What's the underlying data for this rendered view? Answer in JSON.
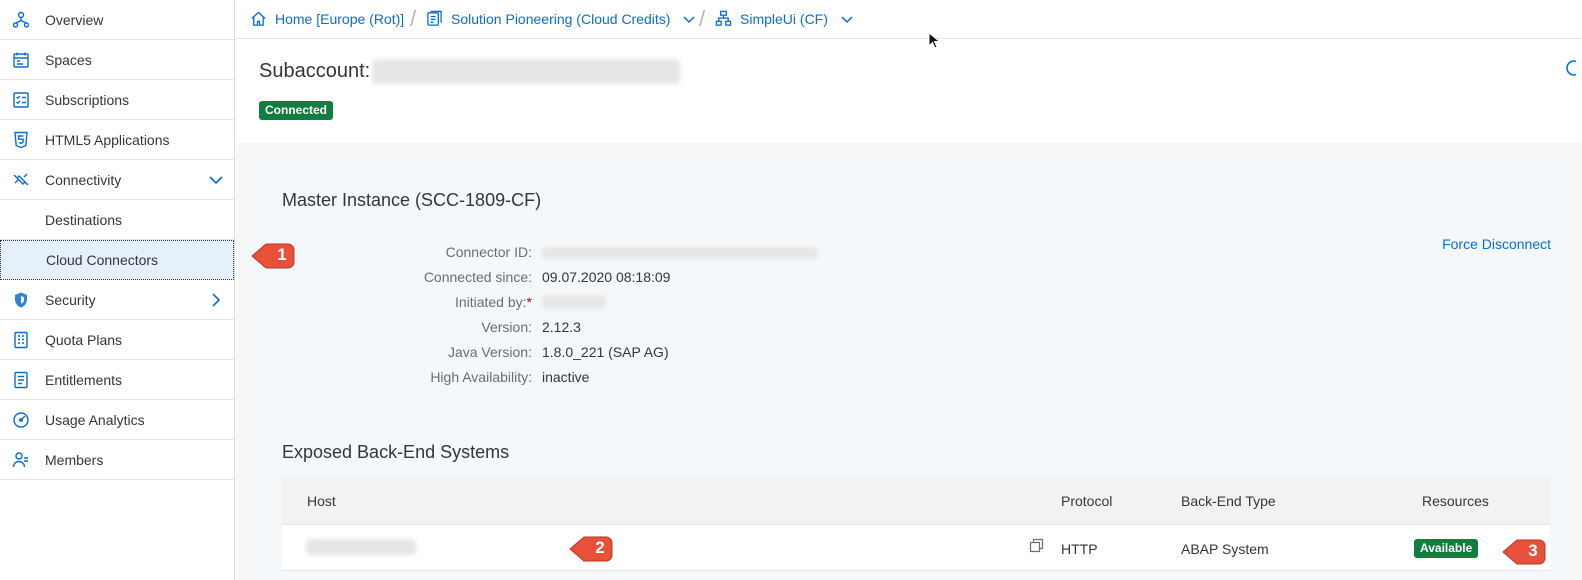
{
  "sidebar": {
    "items": [
      {
        "label": "Overview",
        "icon": "overview-icon"
      },
      {
        "label": "Spaces",
        "icon": "spaces-icon"
      },
      {
        "label": "Subscriptions",
        "icon": "subscriptions-icon"
      },
      {
        "label": "HTML5 Applications",
        "icon": "html5-icon"
      },
      {
        "label": "Connectivity",
        "icon": "connectivity-icon",
        "expanded": true
      },
      {
        "label": "Destinations"
      },
      {
        "label": "Cloud Connectors",
        "selected": true
      },
      {
        "label": "Security",
        "icon": "shield-icon"
      },
      {
        "label": "Quota Plans",
        "icon": "quota-icon"
      },
      {
        "label": "Entitlements",
        "icon": "entitlements-icon"
      },
      {
        "label": "Usage Analytics",
        "icon": "gauge-icon"
      },
      {
        "label": "Members",
        "icon": "members-icon"
      }
    ]
  },
  "breadcrumb": {
    "home": "Home [Europe (Rot)]",
    "globalaccount": "Solution Pioneering (Cloud Credits)",
    "subaccount": "SimpleUi (CF)"
  },
  "header": {
    "title": "Subaccount:",
    "status": "Connected"
  },
  "master": {
    "title": "Master Instance (SCC-1809-CF)",
    "force_disconnect": "Force Disconnect",
    "fields": [
      {
        "label": "Connector ID:",
        "value": ""
      },
      {
        "label": "Connected since:",
        "value": "09.07.2020 08:18:09"
      },
      {
        "label": "Initiated by:",
        "required_mark": "*",
        "value": ""
      },
      {
        "label": "Version:",
        "value": "2.12.3"
      },
      {
        "label": "Java Version:",
        "value": "1.8.0_221 (SAP AG)"
      },
      {
        "label": "High Availability:",
        "value": "inactive"
      }
    ]
  },
  "systems": {
    "title": "Exposed Back-End Systems",
    "columns": {
      "host": "Host",
      "protocol": "Protocol",
      "type": "Back-End Type",
      "resources": "Resources"
    },
    "rows": [
      {
        "host": "",
        "protocol": "HTTP",
        "type": "ABAP System",
        "resources": "Available"
      }
    ]
  },
  "callouts": [
    "1",
    "2",
    "3"
  ],
  "colors": {
    "accent": "#0a6ed1",
    "success": "#107e3e",
    "callout": "#e8503a"
  }
}
